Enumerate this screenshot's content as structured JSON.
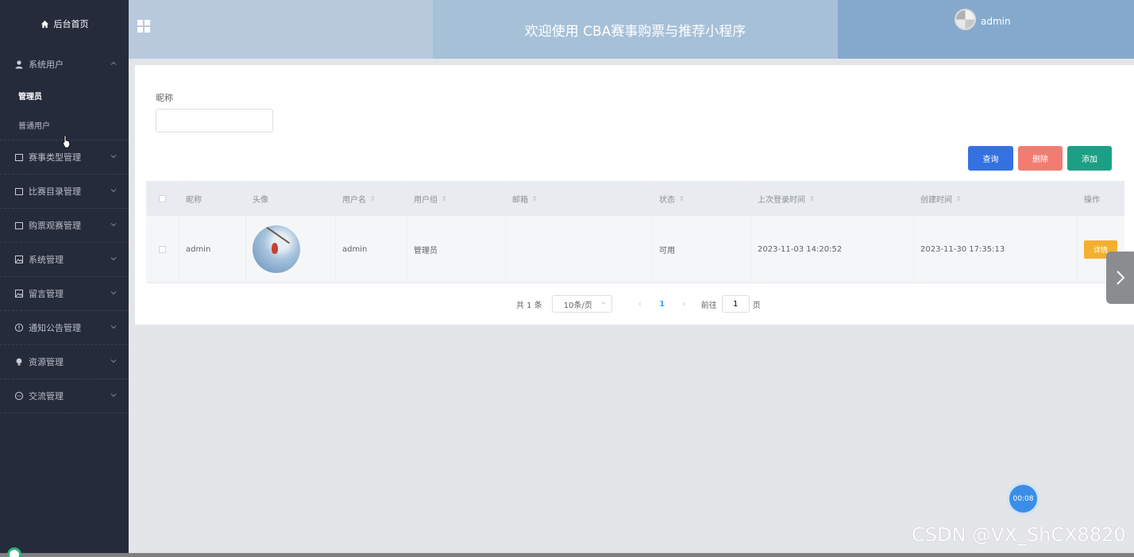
{
  "sidebar": {
    "home_label": "后台首页",
    "groups": [
      {
        "label": "系统用户",
        "expanded": true,
        "icon": "user-icon",
        "children": [
          "管理员",
          "普通用户"
        ],
        "active_child": 0
      },
      {
        "label": "赛事类型管理",
        "icon": "folder-icon"
      },
      {
        "label": "比赛目录管理",
        "icon": "folder-icon"
      },
      {
        "label": "购票观赛管理",
        "icon": "folder-icon"
      },
      {
        "label": "系统管理",
        "icon": "image-icon"
      },
      {
        "label": "留言管理",
        "icon": "image-icon"
      },
      {
        "label": "通知公告管理",
        "icon": "info-icon"
      },
      {
        "label": "资源管理",
        "icon": "bulb-icon"
      },
      {
        "label": "交流管理",
        "icon": "chat-icon"
      }
    ]
  },
  "header": {
    "title": "欢迎使用 CBA赛事购票与推荐小程序",
    "username": "admin"
  },
  "search": {
    "label": "昵称",
    "value": "",
    "query_button": "查询",
    "delete_button": "删除",
    "add_button": "添加"
  },
  "table": {
    "columns": [
      "昵称",
      "头像",
      "用户名",
      "用户组",
      "邮箱",
      "状态",
      "上次登录时间",
      "创建时间",
      "操作"
    ],
    "sortable": [
      false,
      false,
      true,
      true,
      true,
      true,
      true,
      true,
      false
    ],
    "rows": [
      {
        "nickname": "admin",
        "username": "admin",
        "group": "管理员",
        "email": "",
        "status": "可用",
        "last_login": "2023-11-03 14:20:52",
        "created": "2023-11-30 17:35:13",
        "action": "详情"
      }
    ]
  },
  "pagination": {
    "total": "共 1 条",
    "page_size": "10条/页",
    "current_page": "1",
    "goto_label": "前往",
    "goto_value": "1",
    "page_word": "页"
  },
  "timer": "00:08",
  "watermark": "CSDN @VX_ShCX8820",
  "colors": {
    "sidebar_bg": "#262b3c",
    "query": "#3571e0",
    "delete": "#f37c72",
    "add": "#1ca085",
    "detail": "#f3b030"
  }
}
